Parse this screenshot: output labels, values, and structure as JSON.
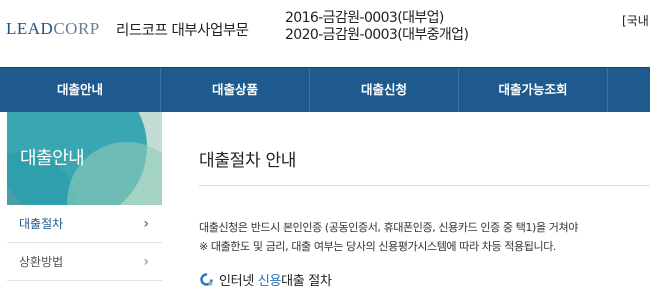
{
  "header": {
    "logo_lead": "LEAD",
    "logo_corp": "CORP",
    "company_name": "리드코프 대부사업부문",
    "reg1": "2016-금감원-0003(대부업)",
    "reg2": "2020-금감원-0003(대부중개업)",
    "lang": "[국내"
  },
  "nav": {
    "items": [
      "대출안내",
      "대출상품",
      "대출신청",
      "대출가능조회"
    ]
  },
  "sidebar": {
    "title": "대출안내",
    "items": [
      {
        "label": "대출절차",
        "active": true
      },
      {
        "label": "상환방법",
        "active": false
      }
    ]
  },
  "main": {
    "title": "대출절차 안내",
    "para1": "대출신청은 반드시 본인인증 (공동인증서, 휴대폰인증, 신용카드 인증 중 택1)을 거쳐야",
    "para2": "※ 대출한도 및 금리, 대출 여부는 당사의 신용평가시스템에 따라 차등 적용됩니다.",
    "proc_prefix": "인터넷 ",
    "proc_highlight": "신용",
    "proc_suffix": "대출 절차"
  },
  "colors": {
    "nav_bg": "#1f5a8f",
    "accent": "#2c74b8",
    "sidebar_banner": "#c3dcd3"
  },
  "icons": [
    "chevron-right-icon",
    "circle-bullet-icon"
  ]
}
